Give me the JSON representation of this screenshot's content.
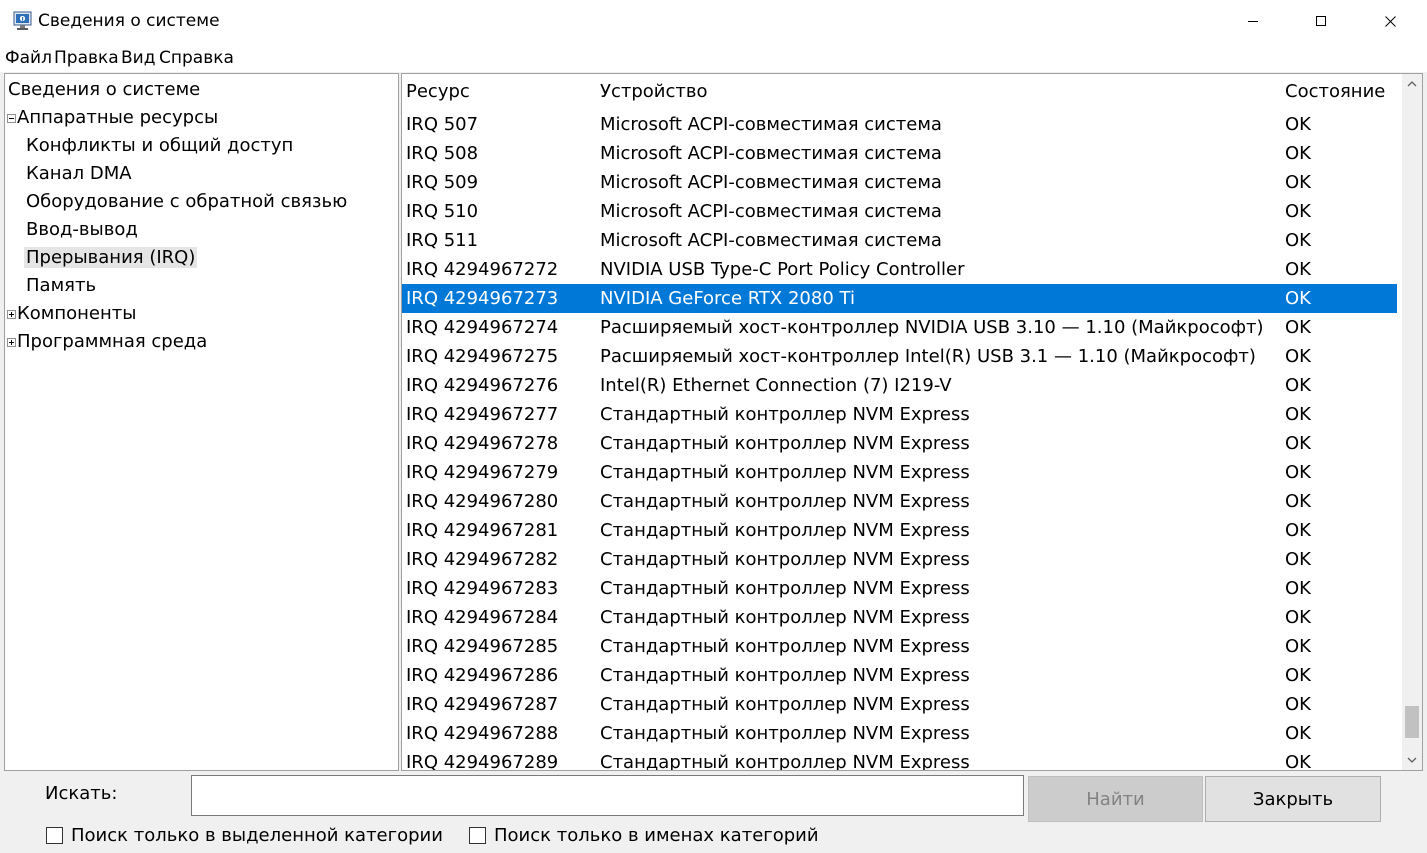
{
  "window": {
    "title": "Сведения о системе",
    "icon": "system-info-icon"
  },
  "menu": [
    "Файл",
    "Правка",
    "Вид",
    "Справка"
  ],
  "tree": {
    "root": "Сведения о системе",
    "hardware": "Аппаратные ресурсы",
    "hardware_children": [
      "Конфликты и общий доступ",
      "Канал DMA",
      "Оборудование с обратной связью",
      "Ввод-вывод",
      "Прерывания (IRQ)",
      "Память"
    ],
    "selected": "Прерывания (IRQ)",
    "components": "Компоненты",
    "software": "Программная среда"
  },
  "table": {
    "headers": [
      "Ресурс",
      "Устройство",
      "Состояние"
    ],
    "selected_index": 6,
    "rows": [
      [
        "IRQ 507",
        "Microsoft ACPI-совместимая система",
        "OK"
      ],
      [
        "IRQ 508",
        "Microsoft ACPI-совместимая система",
        "OK"
      ],
      [
        "IRQ 509",
        "Microsoft ACPI-совместимая система",
        "OK"
      ],
      [
        "IRQ 510",
        "Microsoft ACPI-совместимая система",
        "OK"
      ],
      [
        "IRQ 511",
        "Microsoft ACPI-совместимая система",
        "OK"
      ],
      [
        "IRQ 4294967272",
        "NVIDIA USB Type-C Port Policy Controller",
        "OK"
      ],
      [
        "IRQ 4294967273",
        "NVIDIA GeForce RTX 2080 Ti",
        "OK"
      ],
      [
        "IRQ 4294967274",
        "Расширяемый хост-контроллер NVIDIA USB 3.10 — 1.10 (Майкрософт)",
        "OK"
      ],
      [
        "IRQ 4294967275",
        "Расширяемый хост-контроллер Intel(R) USB 3.1 — 1.10 (Майкрософт)",
        "OK"
      ],
      [
        "IRQ 4294967276",
        "Intel(R) Ethernet Connection (7) I219-V",
        "OK"
      ],
      [
        "IRQ 4294967277",
        "Стандартный контроллер NVM Express",
        "OK"
      ],
      [
        "IRQ 4294967278",
        "Стандартный контроллер NVM Express",
        "OK"
      ],
      [
        "IRQ 4294967279",
        "Стандартный контроллер NVM Express",
        "OK"
      ],
      [
        "IRQ 4294967280",
        "Стандартный контроллер NVM Express",
        "OK"
      ],
      [
        "IRQ 4294967281",
        "Стандартный контроллер NVM Express",
        "OK"
      ],
      [
        "IRQ 4294967282",
        "Стандартный контроллер NVM Express",
        "OK"
      ],
      [
        "IRQ 4294967283",
        "Стандартный контроллер NVM Express",
        "OK"
      ],
      [
        "IRQ 4294967284",
        "Стандартный контроллер NVM Express",
        "OK"
      ],
      [
        "IRQ 4294967285",
        "Стандартный контроллер NVM Express",
        "OK"
      ],
      [
        "IRQ 4294967286",
        "Стандартный контроллер NVM Express",
        "OK"
      ],
      [
        "IRQ 4294967287",
        "Стандартный контроллер NVM Express",
        "OK"
      ],
      [
        "IRQ 4294967288",
        "Стандартный контроллер NVM Express",
        "OK"
      ],
      [
        "IRQ 4294967289",
        "Стандартный контроллер NVM Express",
        "OK"
      ]
    ]
  },
  "search": {
    "label": "Искать:",
    "value": "",
    "find_button": "Найти",
    "close_button": "Закрыть",
    "option_selected_category": "Поиск только в выделенной категории",
    "option_category_names": "Поиск только в именах категорий"
  },
  "colors": {
    "selection": "#0078d7",
    "tree_selection": "#e5e5e5"
  }
}
